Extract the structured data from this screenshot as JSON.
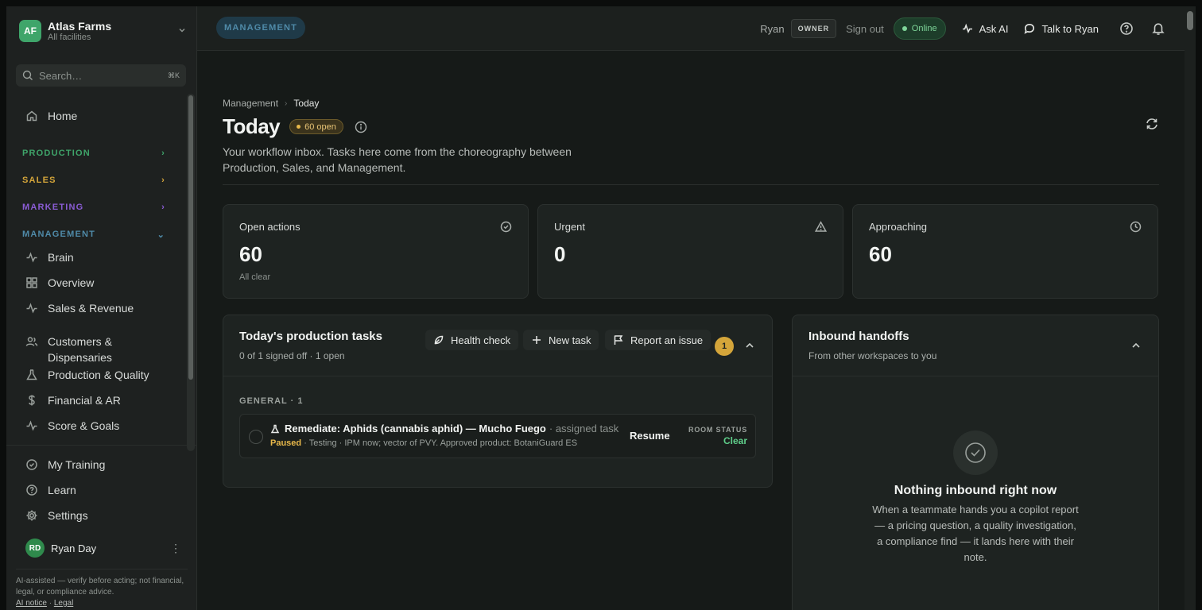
{
  "org": {
    "initials": "AF",
    "name": "Atlas Farms",
    "subtitle": "All facilities"
  },
  "search": {
    "placeholder": "Search…",
    "shortcut": "⌘K"
  },
  "sidebar": {
    "home": "Home",
    "sections": {
      "production": "PRODUCTION",
      "sales": "SALES",
      "marketing": "MARKETING",
      "management": "MANAGEMENT"
    },
    "management_items": [
      "Brain",
      "Overview",
      "Sales & Revenue",
      "Customers &",
      "Dispensaries",
      "Production & Quality",
      "Financial & AR",
      "Score & Goals"
    ],
    "bottom_items": [
      "My Training",
      "Learn",
      "Settings"
    ],
    "user": {
      "initials": "RD",
      "name": "Ryan Day"
    },
    "disclaimer": "AI-assisted — verify before acting; not financial, legal, or compliance advice.",
    "links": {
      "ai_notice": "AI notice",
      "sep": "·",
      "legal": "Legal"
    }
  },
  "topbar": {
    "workspace_pill": "MANAGEMENT",
    "user": "Ryan",
    "role": "OWNER",
    "sign_out": "Sign out",
    "status": "Online",
    "ask_ai": "Ask AI",
    "talk_to": "Talk to Ryan"
  },
  "page": {
    "breadcrumb": [
      "Management",
      "Today"
    ],
    "title": "Today",
    "open_badge": "60 open",
    "description": "Your workflow inbox. Tasks here come from the choreography between Production, Sales, and Management."
  },
  "stats": [
    {
      "label": "Open actions",
      "value": "60",
      "sub": "All clear",
      "icon": "check-circle-icon"
    },
    {
      "label": "Urgent",
      "value": "0",
      "sub": "",
      "icon": "warning-icon"
    },
    {
      "label": "Approaching",
      "value": "60",
      "sub": "",
      "icon": "clock-icon"
    }
  ],
  "production_tasks": {
    "title": "Today's production tasks",
    "subtitle": "0 of 1 signed off · 1 open",
    "buttons": {
      "health": "Health check",
      "new_task": "New task",
      "report": "Report an issue"
    },
    "count": "1",
    "group": "GENERAL · 1",
    "task": {
      "name": "Remediate: Aphids (cannabis aphid) — Mucho Fuego",
      "type": "· assigned task",
      "status": "Paused",
      "meta": " · Testing · IPM now; vector of PVY. Approved product: BotaniGuard ES",
      "action": "Resume",
      "room_status_label": "ROOM STATUS",
      "room_status": "Clear"
    }
  },
  "inbound": {
    "title": "Inbound handoffs",
    "subtitle": "From other workspaces to you",
    "empty_title": "Nothing inbound right now",
    "empty_text": "When a teammate hands you a copilot report — a pricing question, a quality investigation, a compliance find — it lands here with their note."
  },
  "colors": {
    "production": "#3fa56a",
    "sales": "#d4a53a",
    "marketing": "#8a5cd4",
    "management": "#4f8aa8"
  }
}
